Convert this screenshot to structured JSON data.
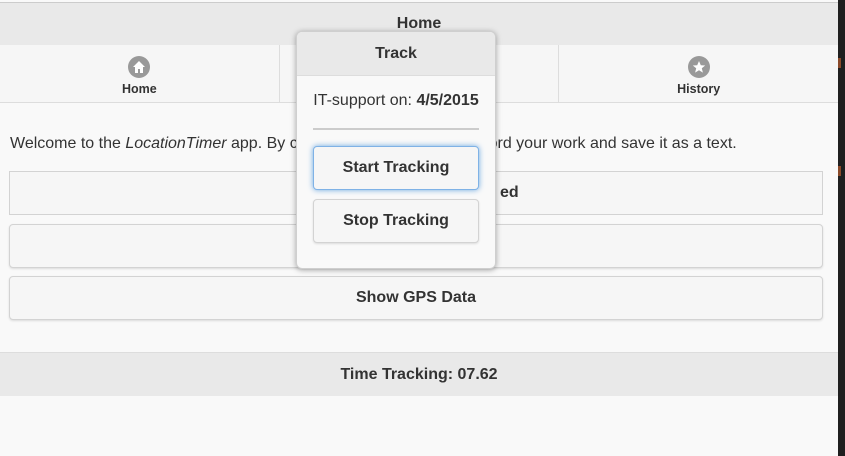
{
  "header": {
    "title": "Home"
  },
  "navbar": {
    "items": [
      {
        "label": "Home",
        "icon": "home-icon"
      },
      {
        "label": "",
        "icon": ""
      },
      {
        "label": "History",
        "icon": "star-icon"
      }
    ]
  },
  "main": {
    "welcome_prefix": "Welcome to the ",
    "welcome_app": "LocationTimer",
    "welcome_suffix_left": " app. By c",
    "welcome_suffix_right": "ecord your work and save it as a text.",
    "button1_label_visible": "ed",
    "button2_label_visible": "",
    "gps_button_label": "Show GPS Data"
  },
  "footer": {
    "text": "Time Tracking: 07.62"
  },
  "popup": {
    "title": "Track",
    "info_label": "IT-support on: ",
    "info_date": "4/5/2015",
    "start_label": "Start Tracking",
    "stop_label": "Stop Tracking"
  },
  "colors": {
    "header_bg": "#e9e9e9",
    "page_bg": "#f9f9f9",
    "focus_ring": "#6aa7e0",
    "icon_bg": "#999999"
  }
}
